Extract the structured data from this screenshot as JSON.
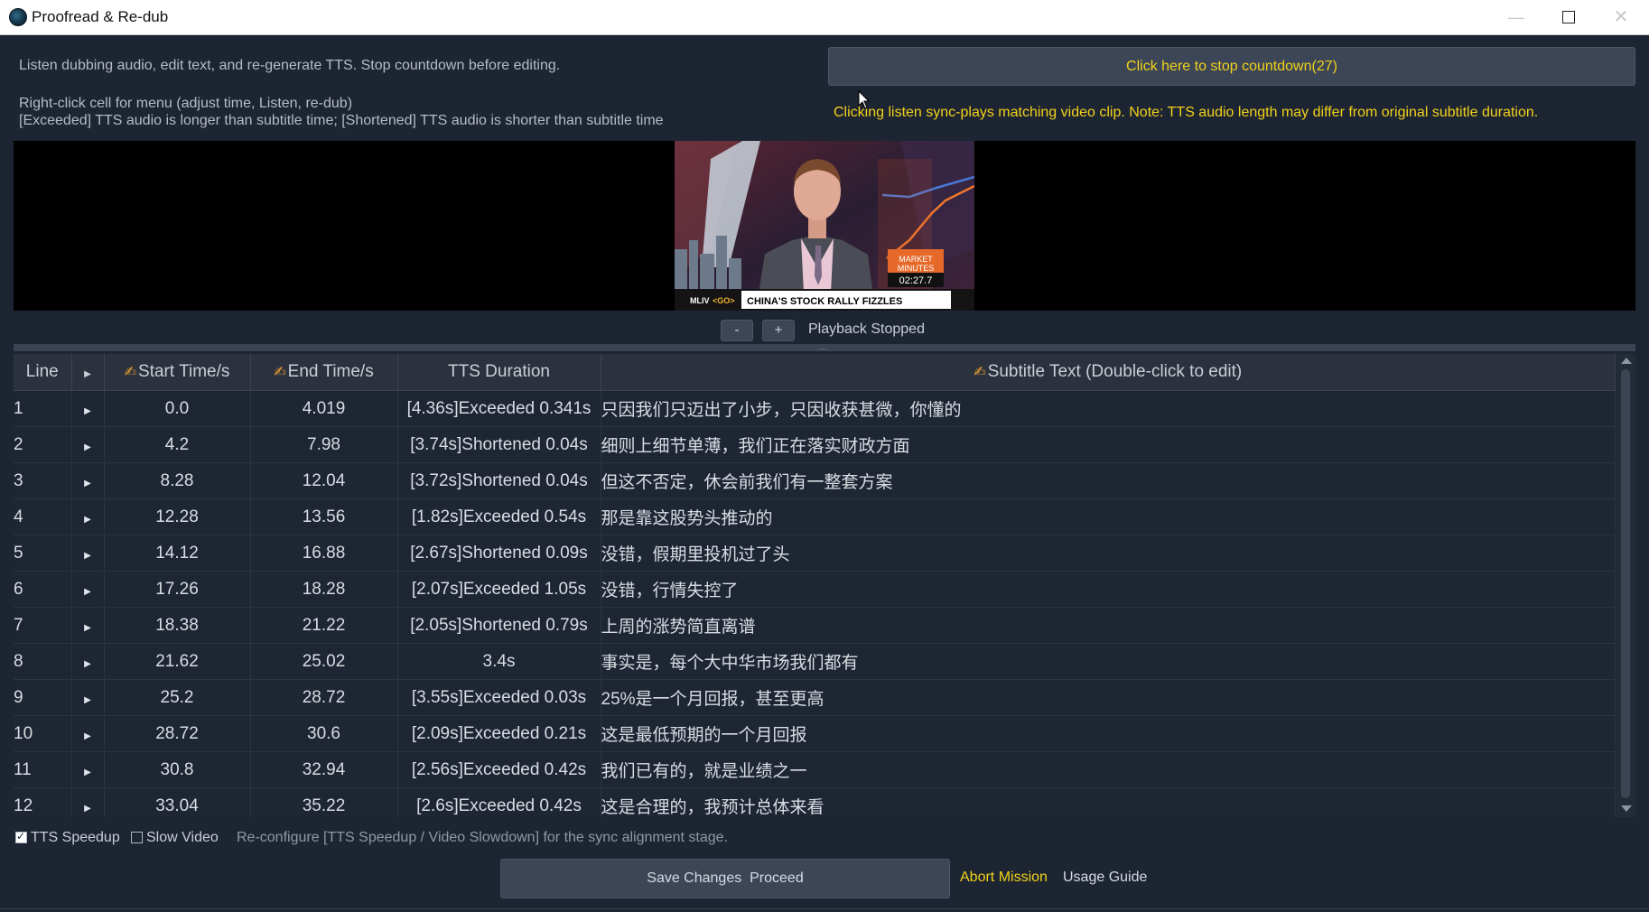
{
  "window": {
    "title": "Proofread & Re-dub",
    "controls": {
      "minimize": "—",
      "close": "✕"
    }
  },
  "notices": {
    "line1": "Listen dubbing audio, edit text, and re-generate TTS. Stop countdown before editing.",
    "line2": "Right-click cell for menu (adjust time, Listen, re-dub)",
    "line3": "[Exceeded] TTS audio is longer than subtitle time; [Shortened] TTS audio is shorter than subtitle time"
  },
  "countdown_button": "Click here to stop countdown(27)",
  "sync_note": "Clicking listen sync-plays matching video clip. Note: TTS audio length may differ from original subtitle duration.",
  "video": {
    "overlay_left": "MLIV",
    "overlay_go": "<GO>",
    "headline": "CHINA'S STOCK RALLY FIZZLES",
    "badge_line1": "MARKET",
    "badge_line2": "MINUTES",
    "badge_time": "02:27.7"
  },
  "playback": {
    "minus": "-",
    "plus": "+",
    "status": "Playback Stopped"
  },
  "table": {
    "headers": {
      "line": "Line",
      "start": "Start Time/s",
      "end": "End Time/s",
      "tts": "TTS Duration",
      "text": "Subtitle Text (Double-click to edit)"
    },
    "rows": [
      {
        "line": "1",
        "start": "0.0",
        "end": "4.019",
        "tts": "[4.36s]Exceeded 0.341s",
        "status": "exceeded",
        "text": "只因我们只迈出了小步，只因收获甚微，你懂的"
      },
      {
        "line": "2",
        "start": "4.2",
        "end": "7.98",
        "tts": "[3.74s]Shortened 0.04s",
        "status": "shortened",
        "text": "细则上细节单薄，我们正在落实财政方面"
      },
      {
        "line": "3",
        "start": "8.28",
        "end": "12.04",
        "tts": "[3.72s]Shortened 0.04s",
        "status": "shortened",
        "text": "但这不否定，休会前我们有一整套方案"
      },
      {
        "line": "4",
        "start": "12.28",
        "end": "13.56",
        "tts": "[1.82s]Exceeded 0.54s",
        "status": "exceeded",
        "text": "那是靠这股势头推动的"
      },
      {
        "line": "5",
        "start": "14.12",
        "end": "16.88",
        "tts": "[2.67s]Shortened 0.09s",
        "status": "shortened",
        "text": "没错，假期里投机过了头"
      },
      {
        "line": "6",
        "start": "17.26",
        "end": "18.28",
        "tts": "[2.07s]Exceeded 1.05s",
        "status": "exceeded",
        "text": "没错，行情失控了"
      },
      {
        "line": "7",
        "start": "18.38",
        "end": "21.22",
        "tts": "[2.05s]Shortened 0.79s",
        "status": "shortened",
        "text": "上周的涨势简直离谱"
      },
      {
        "line": "8",
        "start": "21.62",
        "end": "25.02",
        "tts": "3.4s",
        "status": "ok",
        "text": "事实是，每个大中华市场我们都有"
      },
      {
        "line": "9",
        "start": "25.2",
        "end": "28.72",
        "tts": "[3.55s]Exceeded 0.03s",
        "status": "exceeded",
        "text": "25%是一个月回报，甚至更高"
      },
      {
        "line": "10",
        "start": "28.72",
        "end": "30.6",
        "tts": "[2.09s]Exceeded 0.21s",
        "status": "exceeded",
        "text": "这是最低预期的一个月回报"
      },
      {
        "line": "11",
        "start": "30.8",
        "end": "32.94",
        "tts": "[2.56s]Exceeded 0.42s",
        "status": "exceeded",
        "text": "我们已有的，就是业绩之一"
      },
      {
        "line": "12",
        "start": "33.04",
        "end": "35.22",
        "tts": "[2.6s]Exceeded 0.42s",
        "status": "exceeded",
        "text": "这是合理的，我预计总体来看"
      }
    ]
  },
  "options": {
    "tts_speedup": {
      "label": "TTS Speedup",
      "checked": true
    },
    "slow_video": {
      "label": "Slow Video",
      "checked": false
    },
    "reconfigure_note": "Re-configure [TTS Speedup / Video Slowdown] for the sync alignment stage."
  },
  "actions": {
    "save": "Save Changes  Proceed",
    "abort": "Abort Mission",
    "guide": "Usage Guide"
  },
  "colors": {
    "background": "#1d2532",
    "accent_yellow": "#f2d21b",
    "exceeded": "#ff7b2e",
    "ok": "#4ddc47"
  },
  "icons": {
    "edit": "writing-hand-icon",
    "row_play": "play-triangle-icon"
  }
}
